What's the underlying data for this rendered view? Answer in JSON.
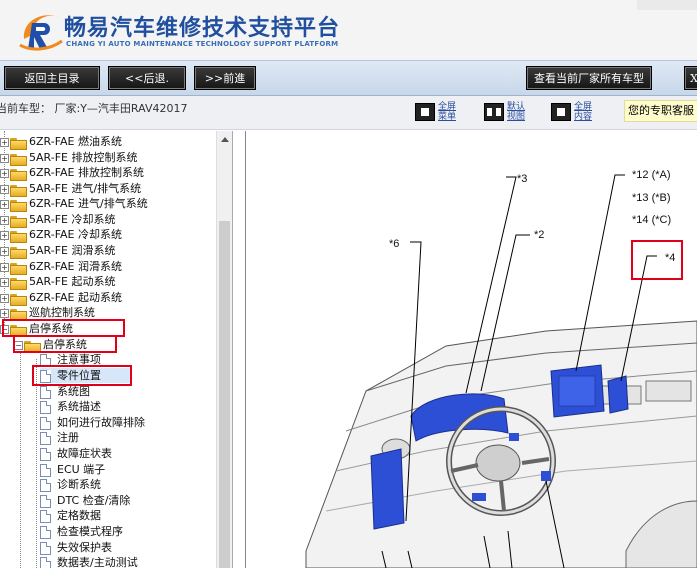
{
  "header": {
    "title_cn": "畅易汽车维修技术支持平台",
    "title_en": "CHANG YI AUTO MAINTENANCE TECHNOLOGY SUPPORT PLATFORM"
  },
  "toolbar": {
    "home_label": "返回主目录",
    "back_label": "<<后退.",
    "forward_label": ">>前進",
    "all_models_label": "查看当前厂家所有车型",
    "close_label": "X"
  },
  "infobar": {
    "car_label": "当前车型： 厂家:Y—汽丰田RAV42017",
    "full_menu": "全屏菜单",
    "default_view": "默认视图",
    "full_content": "全屏内容",
    "service": "您的专职客服"
  },
  "tree": {
    "items": [
      {
        "label": "6ZR-FAE 燃油系统"
      },
      {
        "label": "5AR-FE 排放控制系统"
      },
      {
        "label": "6ZR-FAE 排放控制系统"
      },
      {
        "label": "5AR-FE 进气/排气系统"
      },
      {
        "label": "6ZR-FAE 进气/排气系统"
      },
      {
        "label": "5AR-FE 冷却系统"
      },
      {
        "label": "6ZR-FAE 冷却系统"
      },
      {
        "label": "5AR-FE 润滑系统"
      },
      {
        "label": "6ZR-FAE 润滑系统"
      },
      {
        "label": "5AR-FE 起动系统"
      },
      {
        "label": "6ZR-FAE 起动系统"
      },
      {
        "label": "巡航控制系统"
      },
      {
        "label": "启停系统"
      },
      {
        "label": "启停系统"
      }
    ],
    "docs": [
      {
        "label": "注意事项"
      },
      {
        "label": "零件位置"
      },
      {
        "label": "系统图"
      },
      {
        "label": "系统描述"
      },
      {
        "label": "如何进行故障排除"
      },
      {
        "label": "注册"
      },
      {
        "label": "故障症状表"
      },
      {
        "label": "ECU 端子"
      },
      {
        "label": "诊断系统"
      },
      {
        "label": "DTC 检查/清除"
      },
      {
        "label": "定格数据"
      },
      {
        "label": "检查模式程序"
      },
      {
        "label": "失效保护表"
      },
      {
        "label": "数据表/主动测试"
      }
    ]
  },
  "diagram": {
    "labels": {
      "l3": "*3",
      "l12": "*12 (*A)",
      "l13": "*13 (*B)",
      "l14": "*14 (*C)",
      "l6": "*6",
      "l2": "*2",
      "l4": "*4"
    }
  },
  "colors": {
    "accent_blue": "#1f4f9e",
    "highlight_red": "#e0001a",
    "component_blue": "#2d4fd6"
  }
}
